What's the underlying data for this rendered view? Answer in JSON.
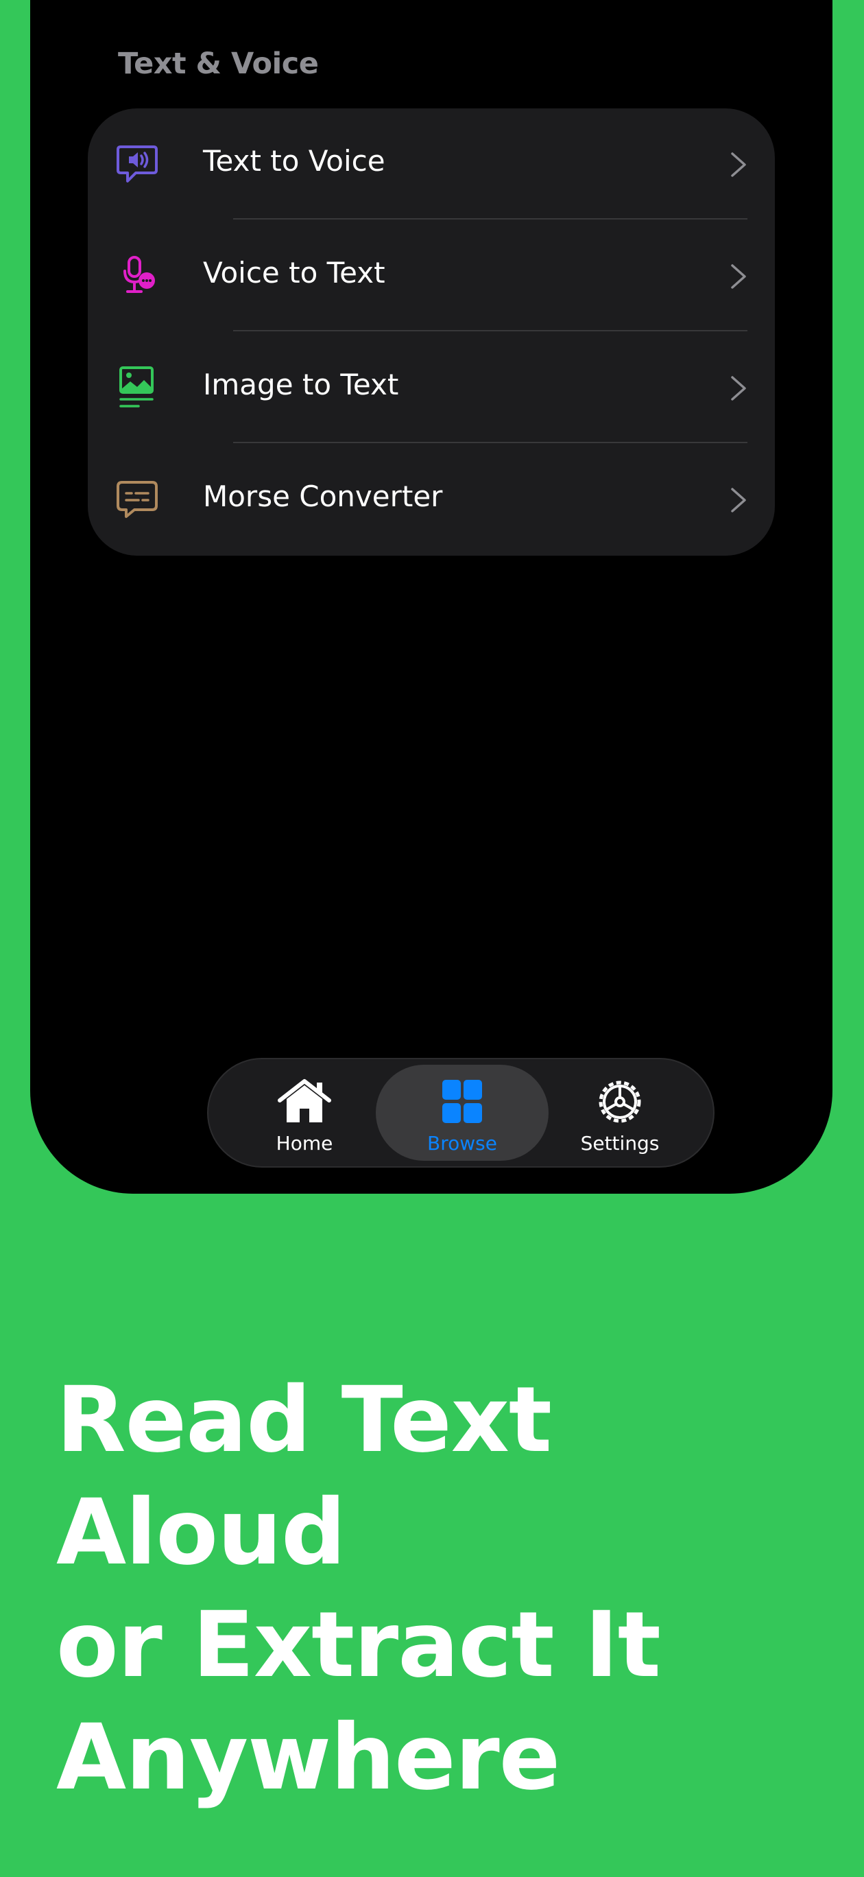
{
  "section": {
    "title": "Text & Voice"
  },
  "menu": {
    "items": [
      {
        "label": "Text to Voice",
        "icon": "speech-bubble-speaker-icon",
        "color": "#6E5BDB"
      },
      {
        "label": "Voice to Text",
        "icon": "microphone-bubble-icon",
        "color": "#E020C8"
      },
      {
        "label": "Image to Text",
        "icon": "image-text-icon",
        "color": "#34C759"
      },
      {
        "label": "Morse Converter",
        "icon": "message-dashes-icon",
        "color": "#B08A5E"
      }
    ]
  },
  "tabbar": {
    "tabs": [
      {
        "label": "Home",
        "icon": "house-icon",
        "active": false
      },
      {
        "label": "Browse",
        "icon": "grid-icon",
        "active": true
      },
      {
        "label": "Settings",
        "icon": "gear-icon",
        "active": false
      }
    ],
    "accent": "#0A84FF"
  },
  "promo": {
    "headline": "Read Text Aloud\nor Extract It\nAnywhere"
  },
  "colors": {
    "background": "#34C759",
    "card": "#1C1C1E",
    "section_title": "#8E8E93"
  }
}
